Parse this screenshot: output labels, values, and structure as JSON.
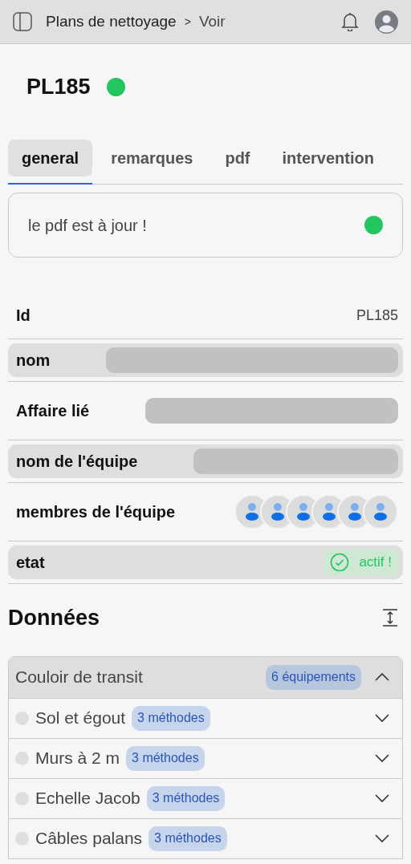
{
  "header": {
    "breadcrumb": [
      "Plans de nettoyage",
      "Voir"
    ],
    "separator": ">"
  },
  "title": {
    "text": "PL185",
    "color": "#22c55e"
  },
  "tabs": [
    {
      "label": "general",
      "selected": true
    },
    {
      "label": "remarques",
      "selected": false
    },
    {
      "label": "pdf",
      "selected": false
    },
    {
      "label": "intervention",
      "selected": false
    }
  ],
  "pdf_status": {
    "text": "le pdf est à jour !",
    "color": "#22c55e"
  },
  "fields": [
    {
      "kind": "text",
      "label": "Id",
      "value": "PL185"
    },
    {
      "kind": "skeleton",
      "label": "nom"
    },
    {
      "kind": "skeleton",
      "label": "Affaire lié"
    },
    {
      "kind": "skeleton",
      "label": "nom de l'équipe"
    },
    {
      "kind": "avatars",
      "label": "membres de l'équipe",
      "avatars": [
        {
          "kind": "person"
        },
        {
          "kind": "person"
        },
        {
          "kind": "person"
        },
        {
          "kind": "person"
        },
        {
          "kind": "person"
        },
        {
          "kind": "person"
        }
      ]
    },
    {
      "kind": "status",
      "label": "etat",
      "value": "actif !",
      "active": true
    }
  ],
  "data_section": {
    "title": "Données",
    "groups": [
      {
        "name": "Couloir de transit",
        "badge": "6 équipements",
        "expanded": true,
        "items": [
          {
            "name": "Sol et égout",
            "badge": "3 méthodes",
            "color": "#dedede",
            "expanded": false
          },
          {
            "name": "Murs à 2 m",
            "badge": "3 méthodes",
            "color": "#dedede",
            "expanded": false
          },
          {
            "name": "Echelle Jacob",
            "badge": "3 méthodes",
            "color": "#dedede",
            "expanded": false
          },
          {
            "name": "Câbles palans",
            "badge": "3 méthodes",
            "color": "#dedede",
            "expanded": false
          }
        ]
      }
    ]
  }
}
